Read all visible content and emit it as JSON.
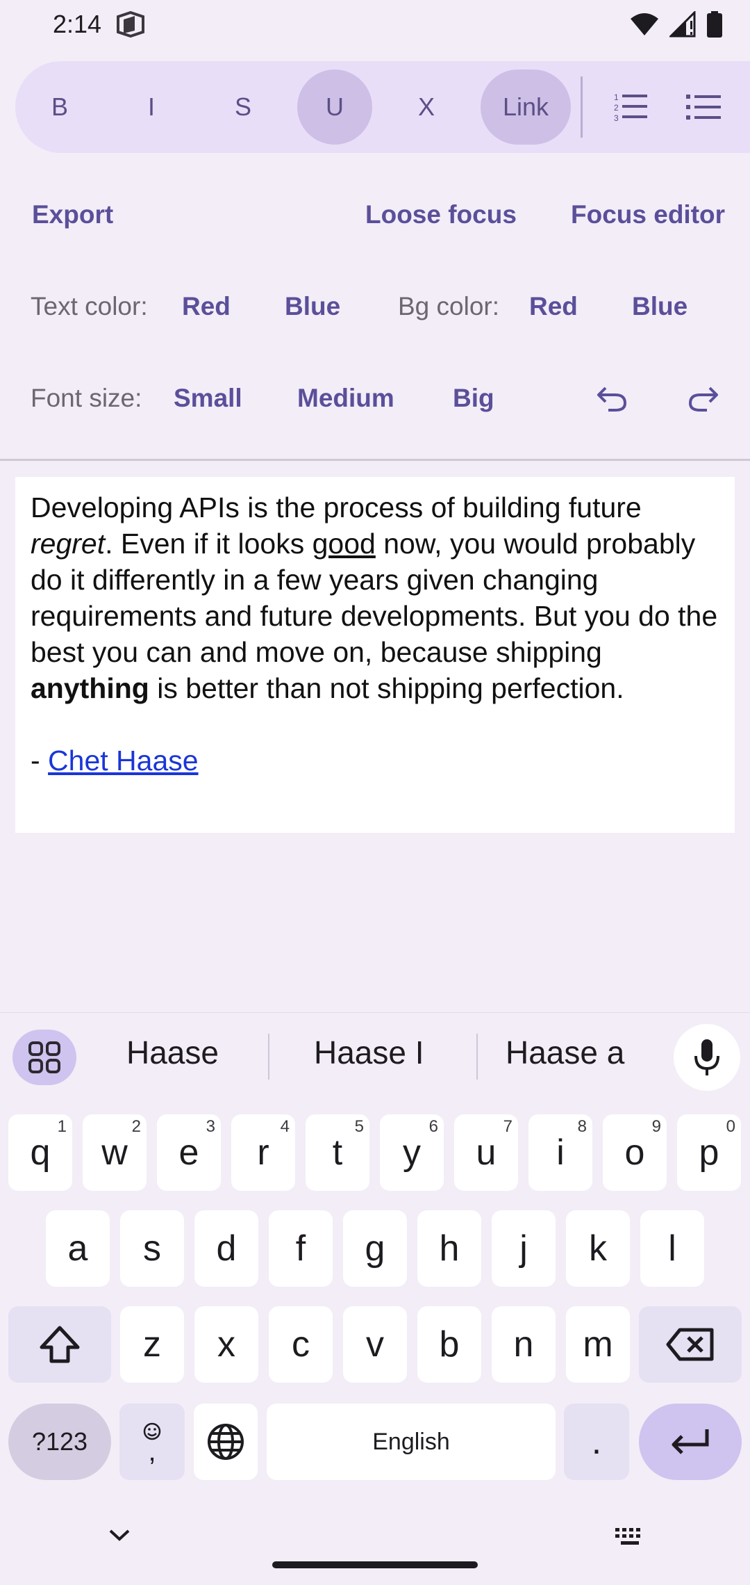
{
  "status": {
    "time": "2:14"
  },
  "toolbar": {
    "buttons": [
      {
        "label": "B",
        "active": false
      },
      {
        "label": "I",
        "active": false
      },
      {
        "label": "S",
        "active": false
      },
      {
        "label": "U",
        "active": true
      },
      {
        "label": "X",
        "active": false
      },
      {
        "label": "Link",
        "active": true
      }
    ],
    "icons": [
      "ordered-list-icon",
      "unordered-list-icon"
    ]
  },
  "actions": {
    "export": "Export",
    "loose_focus": "Loose focus",
    "focus_editor": "Focus editor"
  },
  "colors_row": {
    "text_color_label": "Text color:",
    "text_red": "Red",
    "text_blue": "Blue",
    "bg_color_label": "Bg color:",
    "bg_red": "Red",
    "bg_blue": "Blue"
  },
  "font_row": {
    "label": "Font size:",
    "small": "Small",
    "medium": "Medium",
    "big": "Big",
    "icons": [
      "undo-icon",
      "redo-icon"
    ]
  },
  "editor": {
    "p1_a": "Developing APIs is the process of building future ",
    "p1_italic": "regret",
    "p1_b": ". Even if it looks ",
    "p1_underline": "good",
    "p1_c": " now, you would probably do it differently in a few years given changing requirements and future developments. But you do the best you can and move on, because shipping ",
    "p1_bold": "anything",
    "p1_d": " is better than not shipping perfection.",
    "attribution_prefix": "- ",
    "attribution_link": "Chet Haase"
  },
  "keyboard": {
    "suggestions": [
      "Haase",
      "Haase I",
      "Haase a"
    ],
    "row1": [
      {
        "k": "q",
        "h": "1"
      },
      {
        "k": "w",
        "h": "2"
      },
      {
        "k": "e",
        "h": "3"
      },
      {
        "k": "r",
        "h": "4"
      },
      {
        "k": "t",
        "h": "5"
      },
      {
        "k": "y",
        "h": "6"
      },
      {
        "k": "u",
        "h": "7"
      },
      {
        "k": "i",
        "h": "8"
      },
      {
        "k": "o",
        "h": "9"
      },
      {
        "k": "p",
        "h": "0"
      }
    ],
    "row2": [
      "a",
      "s",
      "d",
      "f",
      "g",
      "h",
      "j",
      "k",
      "l"
    ],
    "row3": [
      "z",
      "x",
      "c",
      "v",
      "b",
      "n",
      "m"
    ],
    "symbols": "?123",
    "emoji_comma": ",",
    "space": "English",
    "period": "."
  },
  "theme": {
    "accent": "#5b4f9a",
    "toolbar_bg": "#e8def8",
    "link": "#1a36d8"
  }
}
